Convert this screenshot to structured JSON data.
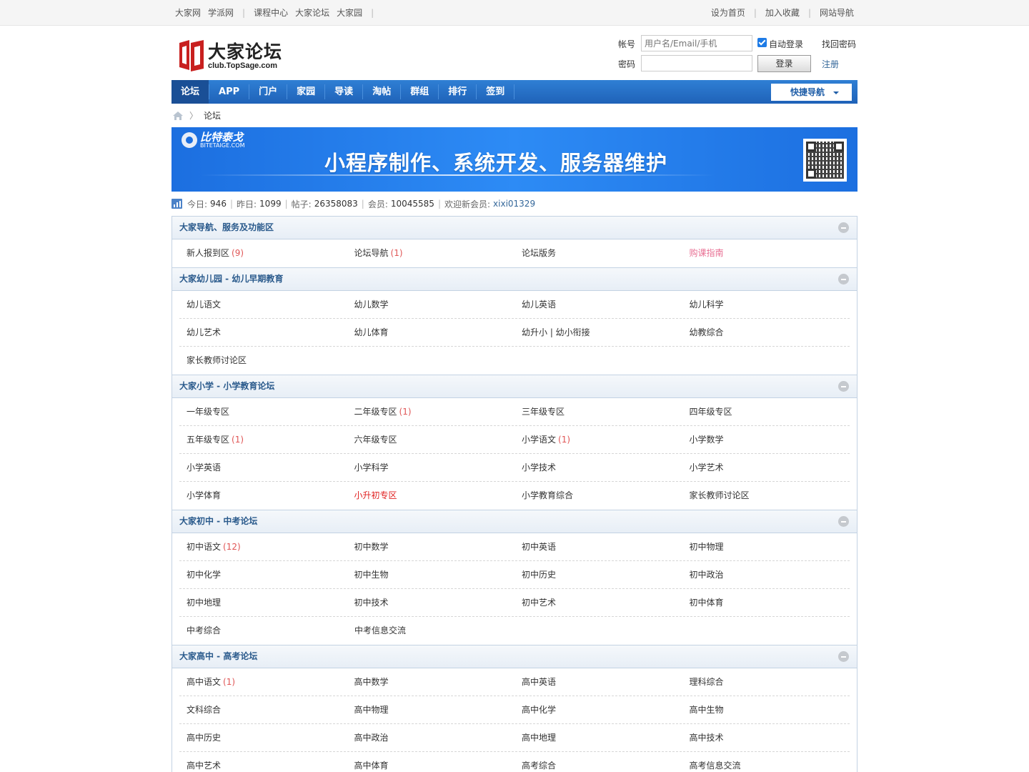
{
  "topbar": {
    "left_links": [
      "大家网",
      "学派网",
      "课程中心",
      "大家论坛",
      "大家园"
    ],
    "right_links": [
      "设为首页",
      "加入收藏",
      "网站导航"
    ]
  },
  "logo": {
    "cn": "大家论坛",
    "en": "club.TopSage.com"
  },
  "login": {
    "account_label": "帐号",
    "account_placeholder": "用户名/Email/手机",
    "auto_login": "自动登录",
    "forgot": "找回密码",
    "password_label": "密码",
    "login_button": "登录",
    "register": "注册"
  },
  "nav": {
    "items": [
      "论坛",
      "APP",
      "门户",
      "家园",
      "导读",
      "淘帖",
      "群组",
      "排行",
      "签到"
    ],
    "quick_nav": "快捷导航"
  },
  "breadcrumb": {
    "current": "论坛"
  },
  "banner": {
    "brand": "比特泰戈",
    "brand_sub": "BITETAIGE.COM",
    "slogan": "小程序制作、系统开发、服务器维护"
  },
  "stats": {
    "today_label": "今日:",
    "today": "946",
    "yesterday_label": "昨日:",
    "yesterday": "1099",
    "posts_label": "帖子:",
    "posts": "26358083",
    "members_label": "会员:",
    "members": "10045585",
    "welcome_label": "欢迎新会员:",
    "welcome": "xixi01329"
  },
  "groups": [
    {
      "title": "大家导航、服务及功能区",
      "rows": [
        [
          {
            "name": "新人报到区",
            "count": "(9)"
          },
          {
            "name": "论坛导航",
            "count": "(1)"
          },
          {
            "name": "论坛版务",
            "count": ""
          },
          {
            "name": "购课指南",
            "count": "",
            "style": "pink"
          }
        ]
      ]
    },
    {
      "title": "大家幼儿园 - 幼儿早期教育",
      "rows": [
        [
          {
            "name": "幼儿语文",
            "count": ""
          },
          {
            "name": "幼儿数学",
            "count": ""
          },
          {
            "name": "幼儿英语",
            "count": ""
          },
          {
            "name": "幼儿科学",
            "count": ""
          }
        ],
        [
          {
            "name": "幼儿艺术",
            "count": ""
          },
          {
            "name": "幼儿体育",
            "count": ""
          },
          {
            "name": "幼升小 | 幼小衔接",
            "count": ""
          },
          {
            "name": "幼教综合",
            "count": ""
          }
        ],
        [
          {
            "name": "家长教师讨论区",
            "count": ""
          }
        ]
      ]
    },
    {
      "title": "大家小学 - 小学教育论坛",
      "rows": [
        [
          {
            "name": "一年级专区",
            "count": ""
          },
          {
            "name": "二年级专区",
            "count": "(1)"
          },
          {
            "name": "三年级专区",
            "count": ""
          },
          {
            "name": "四年级专区",
            "count": ""
          }
        ],
        [
          {
            "name": "五年级专区",
            "count": "(1)"
          },
          {
            "name": "六年级专区",
            "count": ""
          },
          {
            "name": "小学语文",
            "count": "(1)"
          },
          {
            "name": "小学数学",
            "count": ""
          }
        ],
        [
          {
            "name": "小学英语",
            "count": ""
          },
          {
            "name": "小学科学",
            "count": ""
          },
          {
            "name": "小学技术",
            "count": ""
          },
          {
            "name": "小学艺术",
            "count": ""
          }
        ],
        [
          {
            "name": "小学体育",
            "count": ""
          },
          {
            "name": "小升初专区",
            "count": "",
            "style": "red"
          },
          {
            "name": "小学教育综合",
            "count": ""
          },
          {
            "name": "家长教师讨论区",
            "count": ""
          }
        ]
      ]
    },
    {
      "title": "大家初中 - 中考论坛",
      "rows": [
        [
          {
            "name": "初中语文",
            "count": "(12)"
          },
          {
            "name": "初中数学",
            "count": ""
          },
          {
            "name": "初中英语",
            "count": ""
          },
          {
            "name": "初中物理",
            "count": ""
          }
        ],
        [
          {
            "name": "初中化学",
            "count": ""
          },
          {
            "name": "初中生物",
            "count": ""
          },
          {
            "name": "初中历史",
            "count": ""
          },
          {
            "name": "初中政治",
            "count": ""
          }
        ],
        [
          {
            "name": "初中地理",
            "count": ""
          },
          {
            "name": "初中技术",
            "count": ""
          },
          {
            "name": "初中艺术",
            "count": ""
          },
          {
            "name": "初中体育",
            "count": ""
          }
        ],
        [
          {
            "name": "中考综合",
            "count": ""
          },
          {
            "name": "中考信息交流",
            "count": ""
          }
        ]
      ]
    },
    {
      "title": "大家高中 - 高考论坛",
      "rows": [
        [
          {
            "name": "高中语文",
            "count": "(1)"
          },
          {
            "name": "高中数学",
            "count": ""
          },
          {
            "name": "高中英语",
            "count": ""
          },
          {
            "name": "理科综合",
            "count": ""
          }
        ],
        [
          {
            "name": "文科综合",
            "count": ""
          },
          {
            "name": "高中物理",
            "count": ""
          },
          {
            "name": "高中化学",
            "count": ""
          },
          {
            "name": "高中生物",
            "count": ""
          }
        ],
        [
          {
            "name": "高中历史",
            "count": ""
          },
          {
            "name": "高中政治",
            "count": ""
          },
          {
            "name": "高中地理",
            "count": ""
          },
          {
            "name": "高中技术",
            "count": ""
          }
        ],
        [
          {
            "name": "高中艺术",
            "count": ""
          },
          {
            "name": "高中体育",
            "count": ""
          },
          {
            "name": "高考综合",
            "count": ""
          },
          {
            "name": "高考信息交流",
            "count": ""
          }
        ]
      ]
    }
  ],
  "colors": {
    "nav": "#1f62b8",
    "accent": "#2a5a8c",
    "count": "#e05656",
    "pink": "#e86f93",
    "red": "#e02020"
  }
}
